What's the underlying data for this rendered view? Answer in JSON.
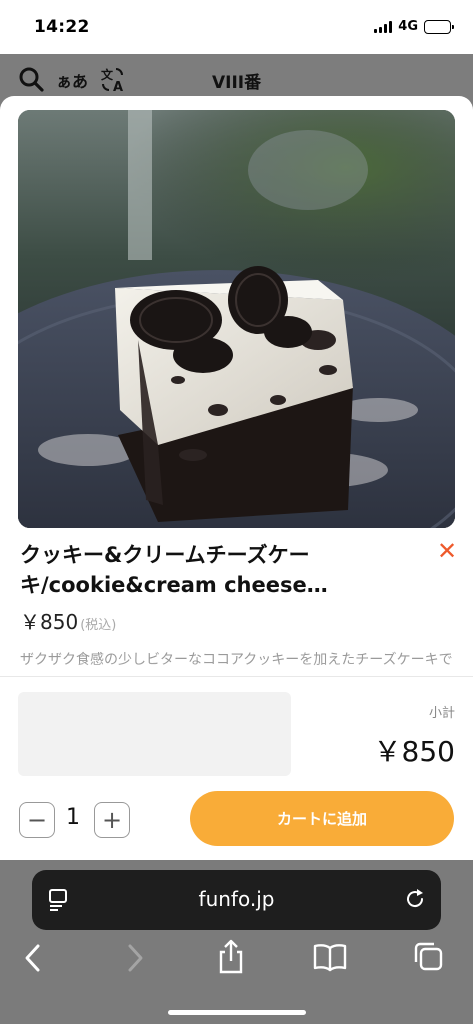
{
  "status_bar": {
    "time": "14:22",
    "network": "4G"
  },
  "site_header": {
    "title": "VIII番",
    "icons": [
      "search-icon",
      "hiragana-toggle-icon",
      "translate-icon"
    ],
    "hiragana_label": "ぁあ"
  },
  "product": {
    "name": "クッキー&クリームチーズケーキ/cookie&cream cheese…",
    "price": "￥850",
    "tax_note": "(税込)",
    "description": "ザクザク食感の少しビターなココアクッキーを加えたチーズケーキです。",
    "close_icon": "close-icon",
    "close_color": "#ee5a2c"
  },
  "order": {
    "subtotal_label": "小計",
    "subtotal_value": "￥850",
    "quantity": "1",
    "minus_label": "−",
    "plus_label": "+",
    "add_to_cart_label": "カートに追加",
    "accent_color": "#f9ac38"
  },
  "browser": {
    "url": "funfo.jp",
    "toolbar_icons": [
      "back-icon",
      "forward-icon",
      "share-icon",
      "bookmarks-icon",
      "tabs-icon"
    ]
  }
}
